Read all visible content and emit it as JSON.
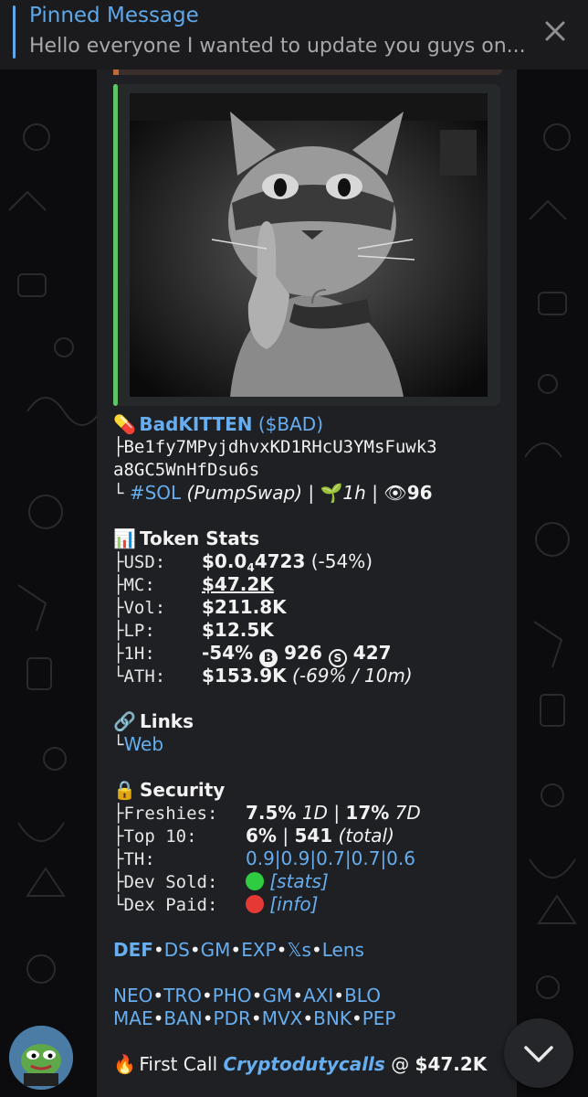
{
  "pinned": {
    "title": "Pinned Message",
    "text": "Hello everyone I wanted to update you guys on..."
  },
  "token": {
    "pill_icon": "pill-icon",
    "name": "BadKITTEN",
    "ticker": "($BAD)",
    "address_line1": "├Be1fy7MPyjdhvxKD1RHcU3YMsFuwk3",
    "address_line2": "a8GC5WnHfDsu6s",
    "chain_prefix": "└",
    "chain": "#SOL",
    "dex": "(PumpSwap)",
    "sep1": "|",
    "age": "1h",
    "sep2": "|",
    "views": "96"
  },
  "stats": {
    "heading": "Token Stats",
    "usd_label": "├USD:",
    "usd_value_a": "$0.0",
    "usd_value_sub": "4",
    "usd_value_b": "4723",
    "usd_change": "(-54%)",
    "mc_label": "├MC:",
    "mc_value": "$47.2K",
    "vol_label": "├Vol:",
    "vol_value": "$211.8K",
    "lp_label": "├LP:",
    "lp_value": "$12.5K",
    "h1_label": "├1H:",
    "h1_change": "-54%",
    "h1_b_icon": "B",
    "h1_buys": "926",
    "h1_s_icon": "S",
    "h1_sells": "427",
    "ath_label": "└ATH:",
    "ath_value": "$153.9K",
    "ath_detail": "(-69% / 10m)"
  },
  "links": {
    "heading": "Links",
    "web_prefix": "└",
    "web": "Web"
  },
  "security": {
    "heading": "Security",
    "freshies_label": "├Freshies:",
    "freshies_1d": "7.5%",
    "freshies_1d_tag": "1D",
    "freshies_sep": "|",
    "freshies_7d": "17%",
    "freshies_7d_tag": "7D",
    "top10_label": "├Top 10:",
    "top10_pct": "6%",
    "top10_sep": "|",
    "top10_count": "541",
    "top10_total": "(total)",
    "th_label": "├TH:",
    "th_values": "0.9|0.9|0.7|0.7|0.6",
    "dev_label": "├Dev Sold:",
    "dev_status_color": "#2ecc40",
    "dev_link": "[stats]",
    "dex_label": "└Dex Paid:",
    "dex_status_color": "#e53935",
    "dex_link": "[info]"
  },
  "tools1": [
    "DEF",
    "DS",
    "GM",
    "EXP",
    "𝕏s",
    "Lens"
  ],
  "tools2": [
    "NEO",
    "TRO",
    "PHO",
    "GM",
    "AXI",
    "BLO"
  ],
  "tools3": [
    "MAE",
    "BAN",
    "PDR",
    "MVX",
    "BNK",
    "PEP"
  ],
  "first_call": {
    "icon": "fire-icon",
    "label": "First Call",
    "caller": "Cryptodutycalls",
    "at": "@",
    "value": "$47.2K"
  },
  "colors": {
    "link": "#66aef0",
    "accent_bar": "#5fc466",
    "pinned_title": "#5ea7e8"
  }
}
